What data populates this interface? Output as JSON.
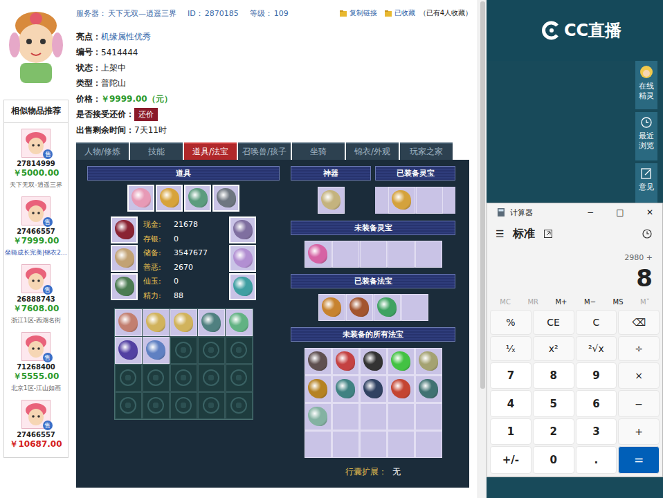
{
  "header": {
    "server_label": "服务器：",
    "server": "天下无双—逍遥三界",
    "id_label": "ID：",
    "id": "2870185",
    "level_label": "等级：",
    "level": "109",
    "copy_link": "复制链接",
    "favorited": "已收藏",
    "fav_count": "（已有4人收藏）"
  },
  "info": [
    {
      "label": "亮点：",
      "value": "机缘属性优秀",
      "kind": "link"
    },
    {
      "label": "编号：",
      "value": "5414444",
      "kind": "plain"
    },
    {
      "label": "状态：",
      "value": "上架中",
      "kind": "plain"
    },
    {
      "label": "类型：",
      "value": "普陀山",
      "kind": "plain"
    },
    {
      "label": "价格：",
      "value": "￥9999.00（元）",
      "kind": "price"
    },
    {
      "label": "是否接受还价：",
      "value": "还价",
      "kind": "button"
    },
    {
      "label": "出售剩余时间：",
      "value": "7天11时",
      "kind": "plain"
    }
  ],
  "tabs": [
    {
      "label": "人物/修炼",
      "selected": false
    },
    {
      "label": "技能",
      "selected": false
    },
    {
      "label": "道具/法宝",
      "selected": true
    },
    {
      "label": "召唤兽/孩子",
      "selected": false
    },
    {
      "label": "坐骑",
      "selected": false
    },
    {
      "label": "锦衣/外观",
      "selected": false
    },
    {
      "label": "玩家之家",
      "selected": false
    }
  ],
  "props": {
    "title": "道具",
    "equipped_top": [
      {
        "filled": true,
        "color": "#e79ab6"
      },
      {
        "filled": true,
        "color": "#d7a33a"
      },
      {
        "filled": true,
        "color": "#5c9c7e"
      },
      {
        "filled": true,
        "color": "#6e7680"
      }
    ],
    "equipped_left": [
      {
        "filled": true,
        "color": "#8a2433"
      },
      {
        "filled": true,
        "color": "#c2a274"
      },
      {
        "filled": true,
        "color": "#4b7b52"
      }
    ],
    "equipped_right": [
      {
        "filled": true,
        "color": "#7f6fa0"
      },
      {
        "filled": true,
        "color": "#b28fd2"
      },
      {
        "filled": true,
        "color": "#3f9fa2"
      }
    ],
    "stats": [
      {
        "label": "现金:",
        "value": "21678"
      },
      {
        "label": "存银:",
        "value": "0"
      },
      {
        "label": "储备:",
        "value": "3547677"
      },
      {
        "label": "善恶:",
        "value": "2670"
      },
      {
        "label": "仙玉:",
        "value": "0"
      },
      {
        "label": "精力:",
        "value": "88"
      }
    ],
    "bag": [
      {
        "filled": true,
        "color": "#c27f70"
      },
      {
        "filled": true,
        "color": "#d1b35c"
      },
      {
        "filled": true,
        "color": "#d1b35c"
      },
      {
        "filled": true,
        "color": "#4f8080"
      },
      {
        "filled": true,
        "color": "#62b283"
      },
      {
        "filled": true,
        "color": "#5240a2"
      },
      {
        "filled": true,
        "color": "#5f80c2"
      },
      {
        "filled": false
      },
      {
        "filled": false
      },
      {
        "filled": false
      },
      {
        "filled": false
      },
      {
        "filled": false
      },
      {
        "filled": false
      },
      {
        "filled": false
      },
      {
        "filled": false
      },
      {
        "filled": false
      },
      {
        "filled": false
      },
      {
        "filled": false
      },
      {
        "filled": false
      },
      {
        "filled": false
      }
    ]
  },
  "artifact": {
    "title": "神器",
    "slots": [
      {
        "filled": true,
        "color": "#c4b37e"
      }
    ]
  },
  "equipped_lingbao": {
    "title": "已装备灵宝",
    "slots": [
      {
        "filled": true,
        "color": "#d4a23c"
      },
      {
        "filled": false
      }
    ]
  },
  "unequipped_lingbao": {
    "title": "未装备灵宝",
    "slots": [
      {
        "filled": true,
        "color": "#d662a4"
      },
      {
        "filled": false
      },
      {
        "filled": false
      },
      {
        "filled": false
      },
      {
        "filled": false
      }
    ]
  },
  "equipped_fabao": {
    "title": "已装备法宝",
    "slots": [
      {
        "filled": true,
        "color": "#c7832f"
      },
      {
        "filled": true,
        "color": "#a3552f"
      },
      {
        "filled": true,
        "color": "#3fa262"
      },
      {
        "filled": false
      }
    ]
  },
  "unequipped_fabao": {
    "title": "未装备的所有法宝",
    "slots": [
      {
        "filled": true,
        "color": "#5f5050"
      },
      {
        "filled": true,
        "color": "#c44242"
      },
      {
        "filled": true,
        "color": "#333333"
      },
      {
        "filled": true,
        "color": "#43c243"
      },
      {
        "filled": true,
        "color": "#a4a272"
      },
      {
        "filled": true,
        "color": "#b58222"
      },
      {
        "filled": true,
        "color": "#408282"
      },
      {
        "filled": true,
        "color": "#304262"
      },
      {
        "filled": true,
        "color": "#c44532"
      },
      {
        "filled": true,
        "color": "#407272"
      },
      {
        "filled": true,
        "color": "#84b2a2"
      },
      {
        "filled": false
      },
      {
        "filled": false
      },
      {
        "filled": false
      },
      {
        "filled": false
      },
      {
        "filled": false
      },
      {
        "filled": false
      },
      {
        "filled": false
      },
      {
        "filled": false
      },
      {
        "filled": false
      }
    ]
  },
  "bag_expand": {
    "label": "行囊扩展：",
    "value": "无"
  },
  "similar": {
    "title": "相似物品推荐",
    "items": [
      {
        "id": "27814999",
        "price": "￥5000.00",
        "color": "#2c9a2c",
        "desc": "天下无双-逍遥三界",
        "kind": "plain",
        "badge": "售"
      },
      {
        "id": "27466557",
        "price": "￥7999.00",
        "color": "#2c9a2c",
        "desc": "坐骑成长完美|锦衣2…",
        "kind": "tag",
        "badge": "售"
      },
      {
        "id": "26888743",
        "price": "￥7608.00",
        "color": "#2c9a2c",
        "desc": "浙江1区-西湖名街",
        "kind": "plain",
        "badge": "售"
      },
      {
        "id": "71268400",
        "price": "￥5555.00",
        "color": "#2c9a2c",
        "desc": "北京1区-江山如画",
        "kind": "plain",
        "badge": "售"
      },
      {
        "id": "27466557",
        "price": "￥10687.00",
        "color": "#d42020",
        "desc": "",
        "kind": "plain",
        "badge": "售"
      }
    ]
  },
  "side": {
    "logo": "CC直播",
    "buttons": [
      {
        "label": "在线精灵",
        "kind": "avatar"
      },
      {
        "label": "最近浏览",
        "kind": "clock"
      },
      {
        "label": "意见",
        "kind": "edit"
      }
    ]
  },
  "calculator": {
    "title": "计算器",
    "controls": [
      "−",
      "□",
      "✕"
    ],
    "menu": "☰",
    "mode": "标准",
    "expression": "2980 +",
    "display": "8",
    "memory": [
      {
        "label": "MC",
        "disabled": true
      },
      {
        "label": "MR",
        "disabled": true
      },
      {
        "label": "M+",
        "disabled": false
      },
      {
        "label": "M−",
        "disabled": false
      },
      {
        "label": "MS",
        "disabled": false
      },
      {
        "label": "M˅",
        "disabled": true
      }
    ],
    "keys": [
      {
        "label": "%",
        "kind": "fn"
      },
      {
        "label": "CE",
        "kind": "fn"
      },
      {
        "label": "C",
        "kind": "fn"
      },
      {
        "label": "⌫",
        "kind": "fn"
      },
      {
        "label": "¹⁄ₓ",
        "kind": "fn"
      },
      {
        "label": "x²",
        "kind": "fn"
      },
      {
        "label": "²√x",
        "kind": "fn"
      },
      {
        "label": "÷",
        "kind": "fn"
      },
      {
        "label": "7",
        "kind": "num"
      },
      {
        "label": "8",
        "kind": "num"
      },
      {
        "label": "9",
        "kind": "num"
      },
      {
        "label": "×",
        "kind": "fn"
      },
      {
        "label": "4",
        "kind": "num"
      },
      {
        "label": "5",
        "kind": "num"
      },
      {
        "label": "6",
        "kind": "num"
      },
      {
        "label": "−",
        "kind": "fn"
      },
      {
        "label": "1",
        "kind": "num"
      },
      {
        "label": "2",
        "kind": "num"
      },
      {
        "label": "3",
        "kind": "num"
      },
      {
        "label": "+",
        "kind": "fn"
      },
      {
        "label": "+/-",
        "kind": "num"
      },
      {
        "label": "0",
        "kind": "num"
      },
      {
        "label": ".",
        "kind": "num"
      },
      {
        "label": "=",
        "kind": "eq"
      }
    ]
  }
}
